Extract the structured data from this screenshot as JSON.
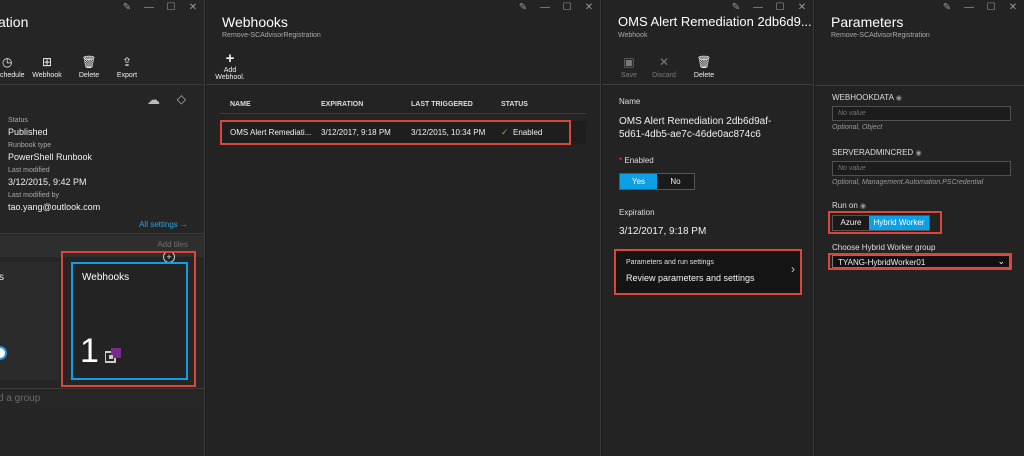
{
  "blade1": {
    "title": "ation",
    "commands": [
      {
        "icon": "clock-icon",
        "glyph": "◷",
        "label": "chedule"
      },
      {
        "icon": "webhook-icon",
        "glyph": "⊞",
        "label": "Webhook"
      },
      {
        "icon": "delete-icon",
        "glyph": "🗑",
        "label": "Delete"
      },
      {
        "icon": "export-icon",
        "glyph": "⇪",
        "label": "Export"
      }
    ],
    "status_label": "Status",
    "status_value": "Published",
    "runbook_type_label": "Runbook type",
    "runbook_type_value": "PowerShell Runbook",
    "last_modified_label": "Last modified",
    "last_modified_value": "3/12/2015, 9:42 PM",
    "last_modified_by_label": "Last modified by",
    "last_modified_by_value": "tao.yang@outlook.com",
    "all_settings": "All settings →",
    "add_tiles": "Add tiles",
    "tile_left_label": "s",
    "webhooks_tile_title": "Webhooks",
    "webhooks_tile_count": "1",
    "add_group": "d a group"
  },
  "blade2": {
    "title": "Webhooks",
    "subtitle": "Remove-SCAdvisorRegistration",
    "add_webhook_line1": "Add",
    "add_webhook_line2": "Webhool.",
    "columns": [
      "NAME",
      "EXPIRATION",
      "LAST TRIGGERED",
      "STATUS"
    ],
    "rows": [
      {
        "name": "OMS Alert Remediati...",
        "expiration": "3/12/2017, 9:18 PM",
        "last_triggered": "3/12/2015, 10:34 PM",
        "status": "Enabled"
      }
    ]
  },
  "blade3": {
    "title": "OMS Alert Remediation 2db6d9...",
    "subtitle": "Webhook",
    "commands": [
      {
        "label": "Save",
        "glyph": "💾",
        "icon": "save-icon"
      },
      {
        "label": "Discard",
        "glyph": "✕",
        "icon": "discard-icon"
      },
      {
        "label": "Delete",
        "glyph": "🗑",
        "icon": "delete-icon"
      }
    ],
    "name_label": "Name",
    "name_value_line1": "OMS Alert Remediation 2db6d9af-",
    "name_value_line2": "5d61-4db5-ae7c-46de0ac874c6",
    "enabled_label": "Enabled",
    "enabled_yes": "Yes",
    "enabled_no": "No",
    "expiration_label": "Expiration",
    "expiration_value": "3/12/2017, 9:18 PM",
    "params_title": "Parameters and run settings",
    "params_desc": "Review parameters and settings"
  },
  "blade4": {
    "title": "Parameters",
    "subtitle": "Remove-SCAdvisorRegistration",
    "webhookdata_label": "WEBHOOKDATA",
    "webhookdata_placeholder": "No value",
    "webhookdata_hint": "Optional, Object",
    "serveradmincred_label": "SERVERADMINCRED",
    "serveradmincred_placeholder": "No value",
    "serveradmincred_hint": "Optional, Management.Automation.PSCredential",
    "run_on_label": "Run on",
    "run_on_azure": "Azure",
    "run_on_hybrid": "Hybrid Worker",
    "group_label": "Choose Hybrid Worker group",
    "group_value": "TYANG-HybridWorker01"
  },
  "colors": {
    "accent": "#0ea0e6",
    "highlight_box": "#d9473c",
    "background": "#232323",
    "enabled_check": "#6fbe44"
  }
}
